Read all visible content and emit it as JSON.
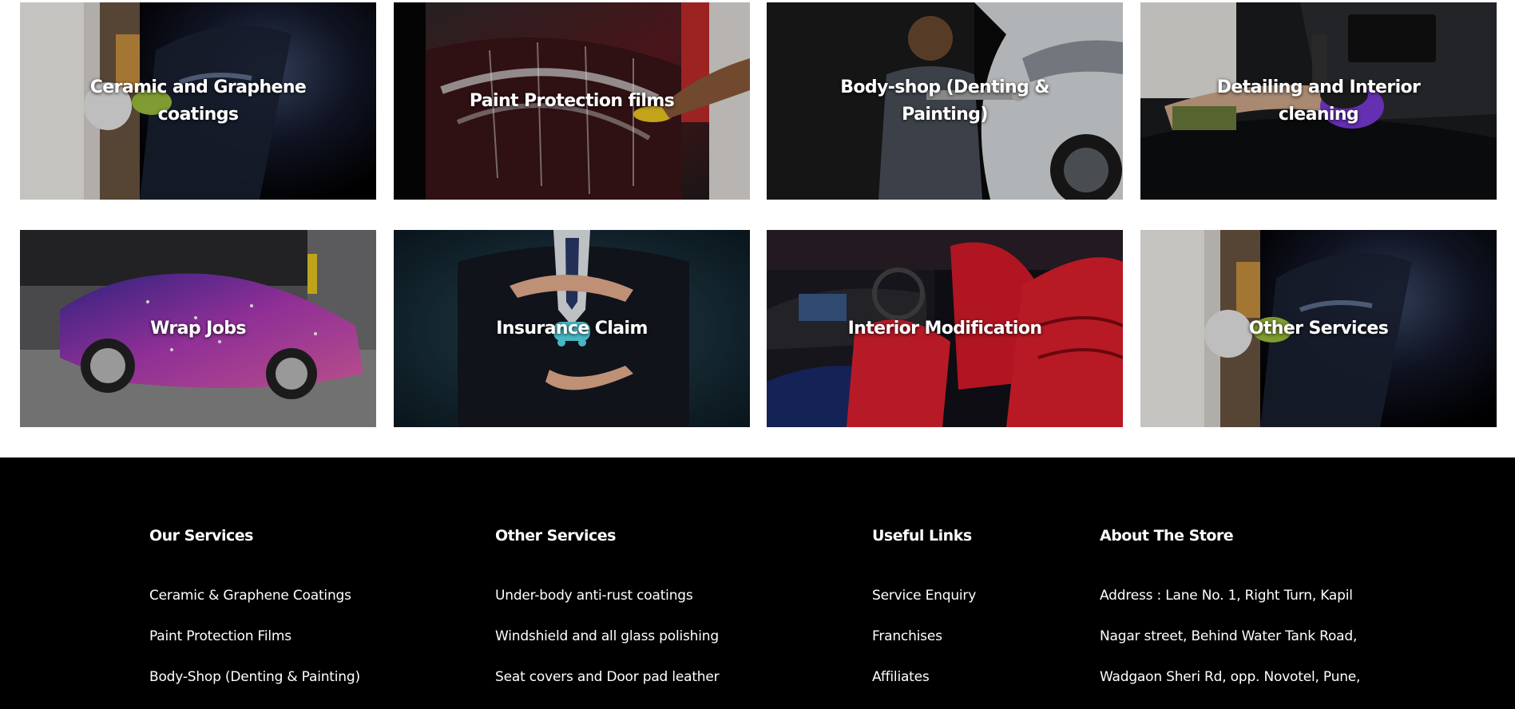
{
  "services": {
    "tiles": [
      {
        "label": "Ceramic and Graphene coatings",
        "icon": "ceramic-coating-photo"
      },
      {
        "label": "Paint Protection films",
        "icon": "paint-protection-photo"
      },
      {
        "label": "Body-shop (Denting & Painting)",
        "icon": "body-shop-photo"
      },
      {
        "label": "Detailing and Interior cleaning",
        "icon": "detailing-photo"
      },
      {
        "label": "Wrap Jobs",
        "icon": "wrap-jobs-photo"
      },
      {
        "label": "Insurance Claim",
        "icon": "insurance-claim-photo"
      },
      {
        "label": "Interior Modification",
        "icon": "interior-modification-photo"
      },
      {
        "label": "Other Services",
        "icon": "other-services-photo"
      }
    ]
  },
  "footer": {
    "our_services": {
      "heading": "Our Services",
      "items": [
        "Ceramic & Graphene Coatings",
        "Paint Protection Films",
        "Body-Shop (Denting & Painting)"
      ]
    },
    "other_services": {
      "heading": "Other Services",
      "items": [
        "Under-body anti-rust coatings",
        "Windshield and all glass polishing",
        "Seat covers and Door pad leather"
      ]
    },
    "useful_links": {
      "heading": "Useful Links",
      "items": [
        "Service Enquiry",
        "Franchises",
        "Affiliates"
      ]
    },
    "about_store": {
      "heading": "About The Store",
      "address_lines": [
        "Address : Lane No. 1, Right Turn, Kapil",
        "Nagar street, Behind Water Tank Road,",
        "Wadgaon Sheri Rd, opp. Novotel, Pune,"
      ]
    }
  },
  "colors": {
    "footer_bg": "#000000",
    "footer_text": "#ffffff",
    "tile_label": "#ffffff",
    "page_bg": "#ffffff"
  }
}
